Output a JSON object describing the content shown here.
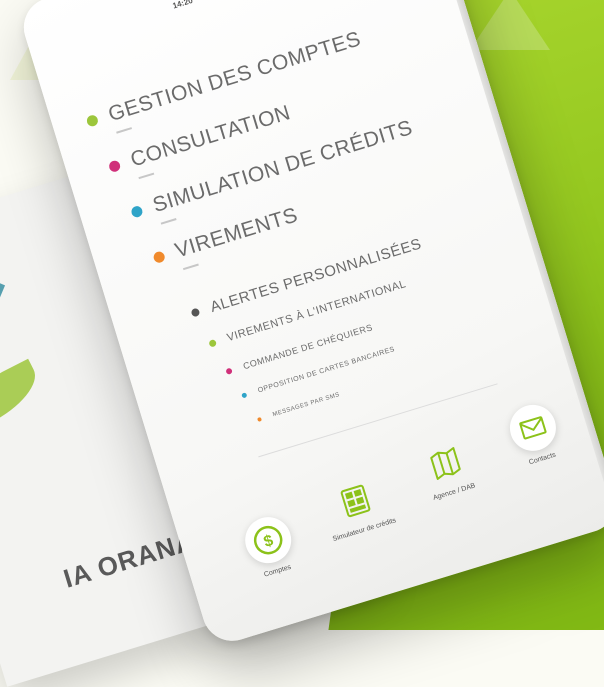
{
  "status_bar": {
    "time": "14:20"
  },
  "menu": {
    "items": [
      {
        "label": "GESTION DES COMPTES",
        "dot_color": "#9cc63b"
      },
      {
        "label": "CONSULTATION",
        "dot_color": "#d0307a"
      },
      {
        "label": "SIMULATION DE CRÉDITS",
        "dot_color": "#2fa4c8"
      },
      {
        "label": "VIREMENTS",
        "dot_color": "#f08a2c"
      }
    ],
    "sub_items": [
      {
        "label": "ALERTES PERSONNALISÉES",
        "dot_color": "#555555"
      },
      {
        "label": "VIREMENTS À L'INTERNATIONAL",
        "dot_color": "#9cc63b"
      },
      {
        "label": "COMMANDE DE CHÉQUIERS",
        "dot_color": "#d0307a"
      },
      {
        "label": "OPPOSITION DE CARTES BANCAIRES",
        "dot_color": "#2fa4c8"
      },
      {
        "label": "MESSAGES PAR SMS",
        "dot_color": "#f08a2c"
      }
    ]
  },
  "bottom_nav": {
    "items": [
      {
        "label": "Comptes",
        "icon": "dollar-circle-icon"
      },
      {
        "label": "Simulateur de crédits",
        "icon": "calculator-icon"
      },
      {
        "label": "Agence / DAB",
        "icon": "map-icon"
      },
      {
        "label": "Contacts",
        "icon": "envelope-icon"
      }
    ]
  },
  "background": {
    "brand_text": "IA ORANA",
    "accent_color": "#8cc21a"
  }
}
